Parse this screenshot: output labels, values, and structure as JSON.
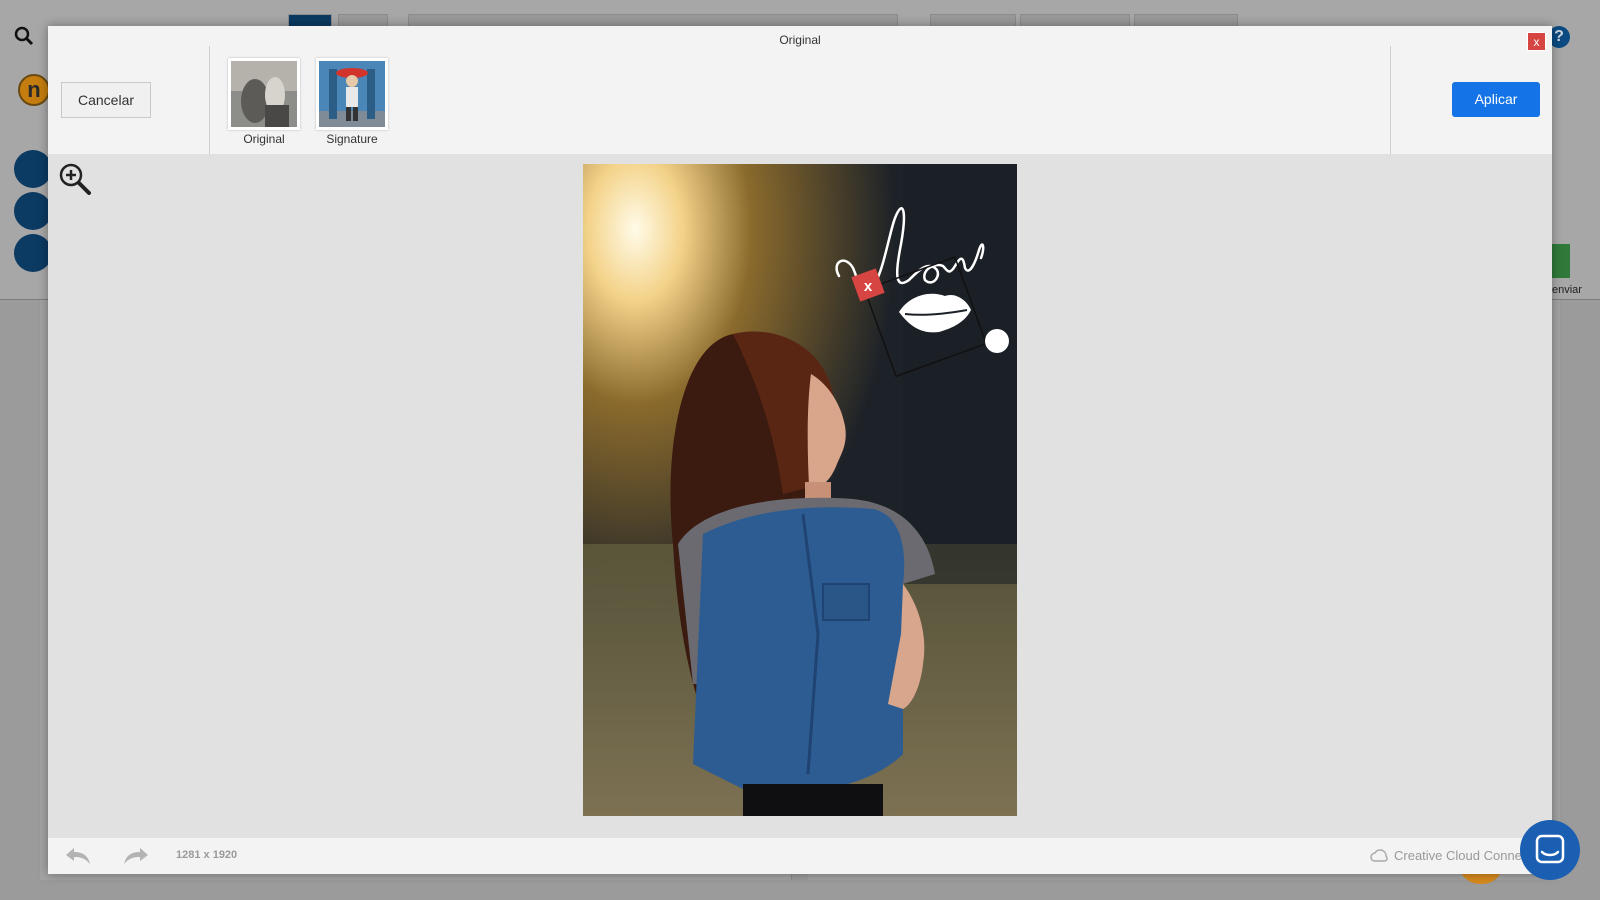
{
  "background_app": {
    "avatar_letter": "n",
    "help_symbol": "?",
    "enviar_label": "enviar"
  },
  "modal": {
    "title": "Original",
    "close_label": "x",
    "cancel_label": "Cancelar",
    "apply_label": "Aplicar",
    "thumbnails": [
      {
        "label": "Original",
        "icon": "photo-thumbnail"
      },
      {
        "label": "Signature",
        "icon": "photo-thumbnail"
      }
    ],
    "sticker": {
      "text": "love",
      "delete_label": "x"
    },
    "footer": {
      "dimensions": "1281 x 1920",
      "cc_label": "Creative Cloud Connec"
    }
  },
  "colors": {
    "accent": "#1473e6",
    "danger": "#d64541",
    "chat": "#1b5fb2"
  }
}
